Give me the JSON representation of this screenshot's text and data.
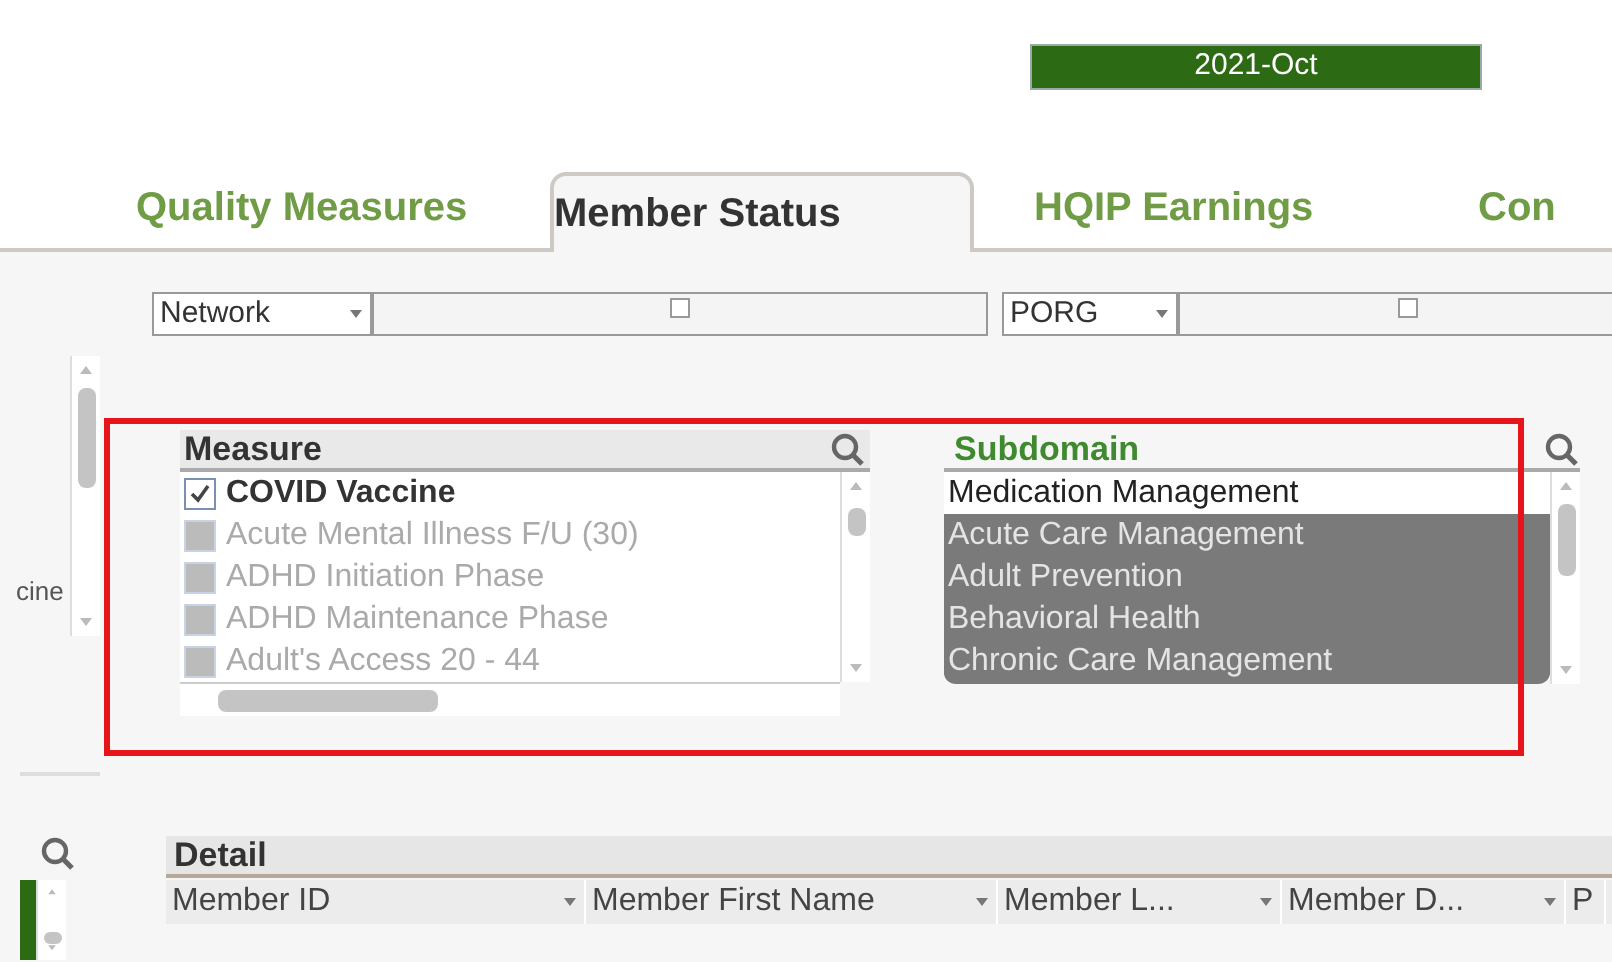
{
  "period": {
    "label": "2021-Oct"
  },
  "tabs": [
    {
      "label": "Quality Measures",
      "selected": false
    },
    {
      "label": "Member Status",
      "selected": true
    },
    {
      "label": "HQIP Earnings",
      "selected": false
    },
    {
      "label": "Con",
      "selected": false
    }
  ],
  "filters": [
    {
      "label": "Network"
    },
    {
      "label": "PORG"
    }
  ],
  "side_list": {
    "visible_text": "cine"
  },
  "measure": {
    "title": "Measure",
    "items": [
      {
        "label": "COVID Vaccine",
        "checked": true
      },
      {
        "label": "Acute Mental Illness F/U (30)",
        "checked": false
      },
      {
        "label": "ADHD Initiation Phase",
        "checked": false
      },
      {
        "label": "ADHD Maintenance Phase",
        "checked": false
      },
      {
        "label": "Adult's Access 20 - 44",
        "checked": false
      }
    ]
  },
  "subdomain": {
    "title": "Subdomain",
    "items": [
      {
        "label": "Medication Management",
        "excluded": false
      },
      {
        "label": "Acute Care Management",
        "excluded": true
      },
      {
        "label": "Adult Prevention",
        "excluded": true
      },
      {
        "label": "Behavioral Health",
        "excluded": true
      },
      {
        "label": "Chronic Care Management",
        "excluded": true
      }
    ]
  },
  "detail": {
    "title": "Detail",
    "columns": [
      {
        "label": "Member ID"
      },
      {
        "label": "Member First Name"
      },
      {
        "label": "Member L..."
      },
      {
        "label": "Member D..."
      },
      {
        "label": "P"
      }
    ]
  }
}
